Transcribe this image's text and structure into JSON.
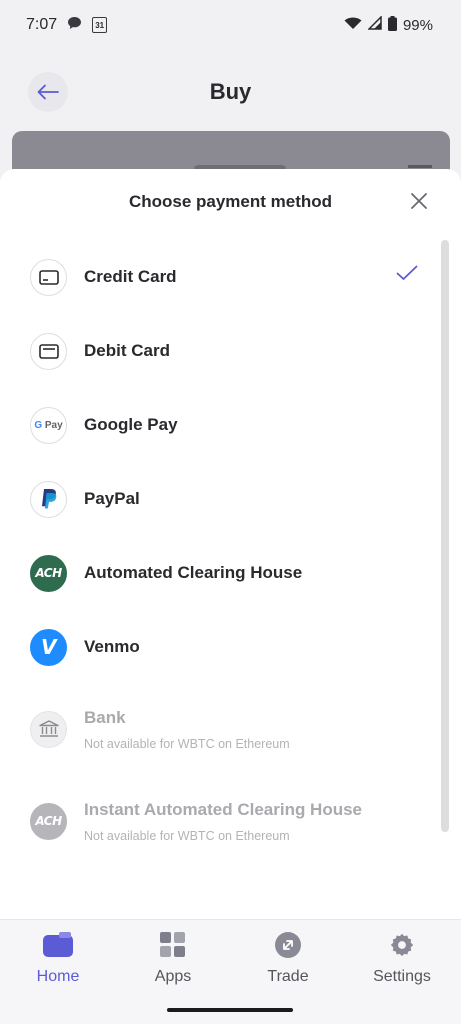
{
  "status_bar": {
    "time": "7:07",
    "calendar_day": "31",
    "battery": "99%"
  },
  "header": {
    "title": "Buy"
  },
  "sheet": {
    "title": "Choose payment method",
    "methods": [
      {
        "name": "Credit Card",
        "selected": true
      },
      {
        "name": "Debit Card"
      },
      {
        "name": "Google Pay",
        "logo": "G Pay"
      },
      {
        "name": "PayPal"
      },
      {
        "name": "Automated Clearing House",
        "logo": "ACH"
      },
      {
        "name": "Venmo",
        "logo": "V"
      },
      {
        "name": "Bank",
        "note": "Not available for WBTC on Ethereum"
      },
      {
        "name": "Instant Automated Clearing House",
        "logo": "ACH",
        "note": "Not available for WBTC on Ethereum"
      }
    ]
  },
  "bottom_nav": {
    "items": [
      {
        "label": "Home",
        "icon": "card-icon",
        "active": true
      },
      {
        "label": "Apps",
        "icon": "grid-icon"
      },
      {
        "label": "Trade",
        "icon": "swap-icon"
      },
      {
        "label": "Settings",
        "icon": "gear-icon"
      }
    ]
  },
  "colors": {
    "accent": "#5b5bd6",
    "ach_green": "#2e6b4f",
    "venmo_blue": "#1e8cff"
  }
}
